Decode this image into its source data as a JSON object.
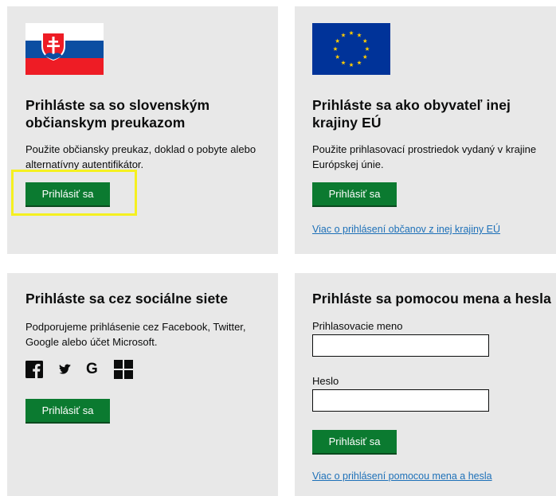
{
  "slovak_card": {
    "flag_icon": "slovak-flag-icon",
    "title": "Prihláste sa so slovenským občianskym preukazom",
    "description": "Použite občiansky preukaz, doklad o pobyte alebo alternatívny autentifikátor.",
    "button_label": "Prihlásiť sa"
  },
  "eu_card": {
    "flag_icon": "eu-flag-icon",
    "title": "Prihláste sa ako obyvateľ inej krajiny EÚ",
    "description": "Použite prihlasovací prostriedok vydaný v krajine Európskej únie.",
    "button_label": "Prihlásiť sa",
    "link_text": "Viac o prihlásení občanov z inej krajiny EÚ"
  },
  "social_card": {
    "title": "Prihláste sa cez sociálne siete",
    "description": "Podporujeme prihlásenie cez Facebook, Twitter, Google alebo účet Microsoft.",
    "icons": [
      "facebook-icon",
      "twitter-icon",
      "google-icon",
      "microsoft-icon"
    ],
    "button_label": "Prihlásiť sa"
  },
  "password_card": {
    "title": "Prihláste sa pomocou mena a hesla",
    "username_label": "Prihlasovacie meno",
    "username_value": "",
    "password_label": "Heslo",
    "password_value": "",
    "button_label": "Prihlásiť sa",
    "link_text": "Viac o prihlásení pomocou mena a hesla"
  },
  "colors": {
    "button_green": "#0b7a30",
    "card_background": "#e8e8e8",
    "link_blue": "#1d70b8",
    "highlight_yellow": "#f5f020"
  }
}
